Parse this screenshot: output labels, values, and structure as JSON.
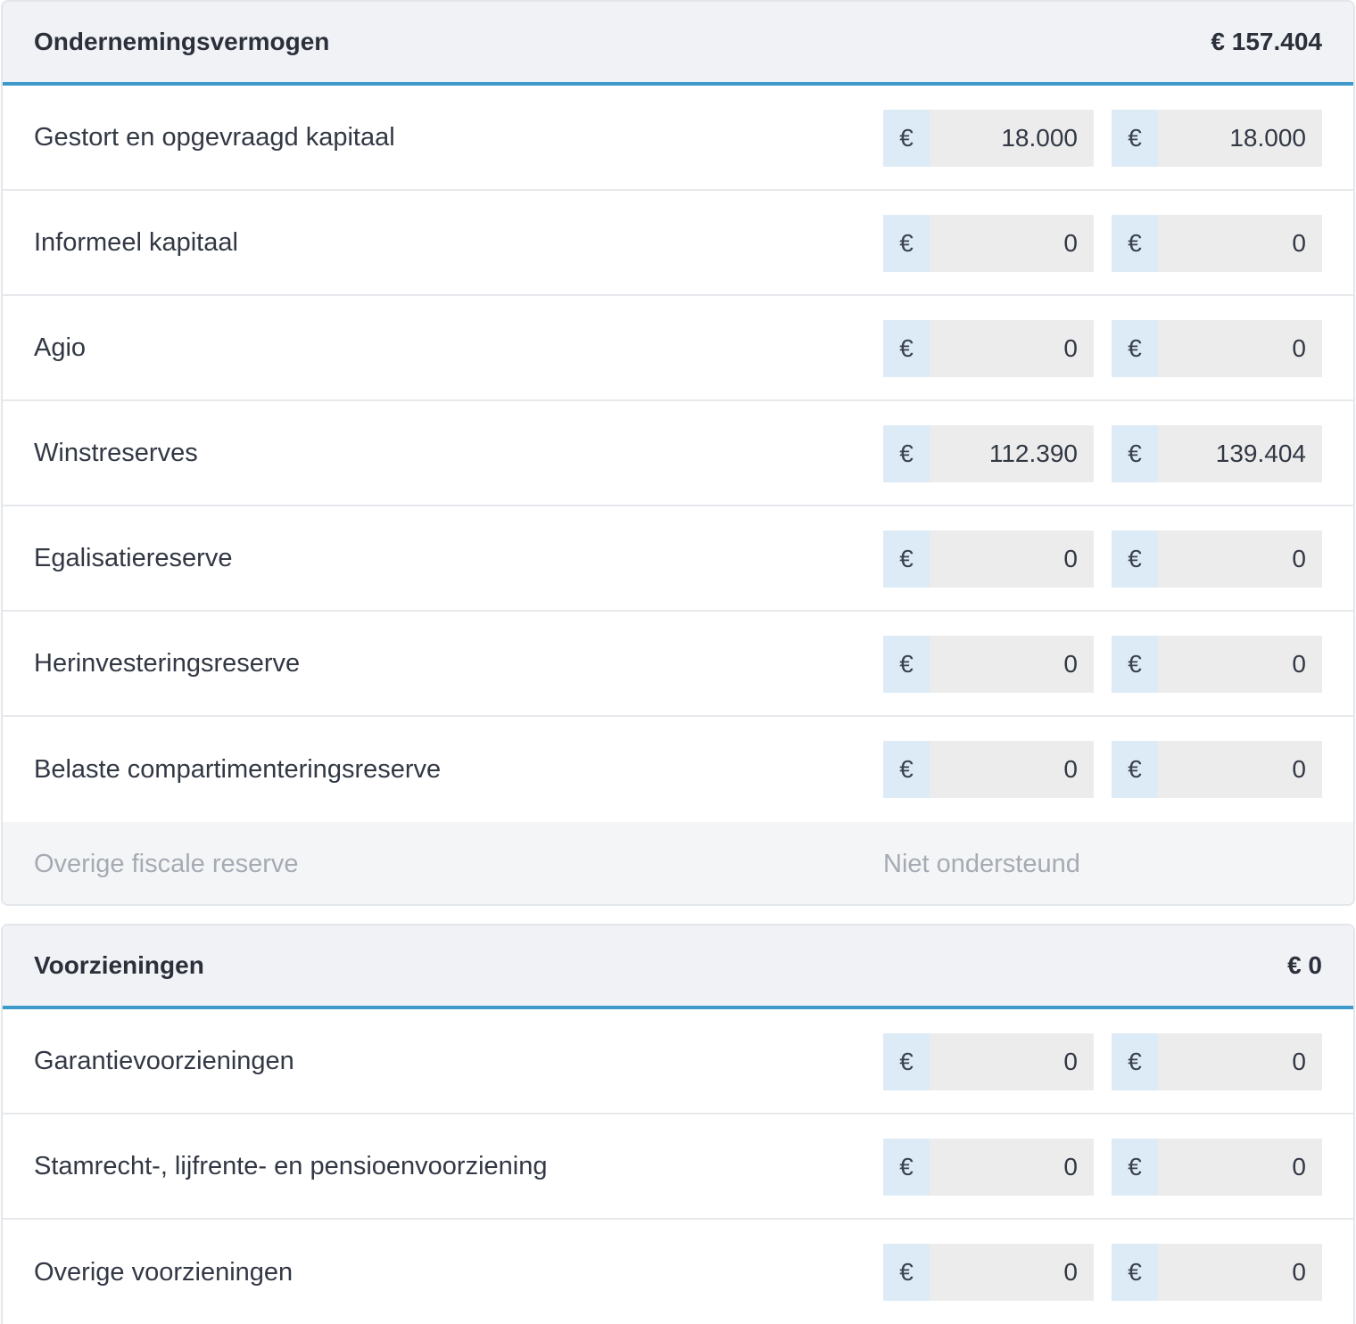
{
  "sections": [
    {
      "title": "Ondernemingsvermogen",
      "total": "€ 157.404",
      "rows": [
        {
          "label": "Gestort en opgevraagd kapitaal",
          "currency": "€",
          "value_a": "18.000",
          "value_b": "18.000"
        },
        {
          "label": "Informeel kapitaal",
          "currency": "€",
          "value_a": "0",
          "value_b": "0"
        },
        {
          "label": "Agio",
          "currency": "€",
          "value_a": "0",
          "value_b": "0"
        },
        {
          "label": "Winstreserves",
          "currency": "€",
          "value_a": "112.390",
          "value_b": "139.404"
        },
        {
          "label": "Egalisatiereserve",
          "currency": "€",
          "value_a": "0",
          "value_b": "0"
        },
        {
          "label": "Herinvesteringsreserve",
          "currency": "€",
          "value_a": "0",
          "value_b": "0"
        },
        {
          "label": "Belaste compartimenteringsreserve",
          "currency": "€",
          "value_a": "0",
          "value_b": "0"
        }
      ],
      "unsupported_row": {
        "label": "Overige fiscale reserve",
        "status": "Niet ondersteund"
      }
    },
    {
      "title": "Voorzieningen",
      "total": "€ 0",
      "rows": [
        {
          "label": "Garantievoorzieningen",
          "currency": "€",
          "value_a": "0",
          "value_b": "0"
        },
        {
          "label": "Stamrecht-, lijfrente- en pensioenvoorziening",
          "currency": "€",
          "value_a": "0",
          "value_b": "0"
        },
        {
          "label": "Overige voorzieningen",
          "currency": "€",
          "value_a": "0",
          "value_b": "0"
        }
      ]
    }
  ],
  "colors": {
    "header_bg": "#f0f2f5",
    "header_accent": "#3d99c9",
    "currency_prefix_bg": "#ddebf7",
    "input_bg": "#ececec",
    "muted_text": "#a6abb3"
  }
}
